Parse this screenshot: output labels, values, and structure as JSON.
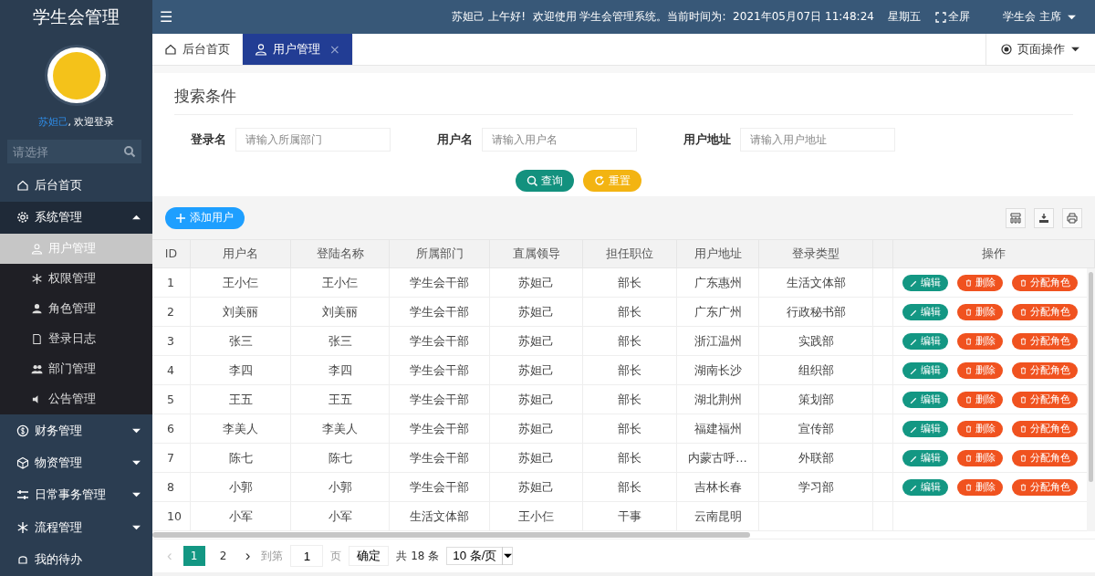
{
  "sidebar": {
    "title": "学生会管理",
    "user_name": "苏妲己",
    "welcome": ", 欢迎登录",
    "search": {
      "placeholder": "请选择"
    },
    "items": [
      {
        "kind": "link",
        "label": "后台首页"
      },
      {
        "kind": "group",
        "label": "系统管理",
        "expanded": true,
        "children": [
          {
            "label": "用户管理",
            "selected": true
          },
          {
            "label": "权限管理",
            "selected": false
          },
          {
            "label": "角色管理",
            "selected": false
          },
          {
            "label": "登录日志",
            "selected": false
          },
          {
            "label": "部门管理",
            "selected": false
          },
          {
            "label": "公告管理",
            "selected": false
          }
        ]
      },
      {
        "kind": "group",
        "label": "财务管理",
        "expanded": false
      },
      {
        "kind": "group",
        "label": "物资管理",
        "expanded": false
      },
      {
        "kind": "group",
        "label": "日常事务管理",
        "expanded": false
      },
      {
        "kind": "group",
        "label": "流程管理",
        "expanded": false
      },
      {
        "kind": "link",
        "label": "我的待办"
      }
    ]
  },
  "topbar": {
    "menu_glyph": "☰",
    "greeting": "苏妲己 上午好!  欢迎使用 学生会管理系统。当前时间为:  2021年05月07日 11:48:24    星期五",
    "fullscreen": "全屏",
    "user": "学生会 主席"
  },
  "tabs": [
    {
      "label": "后台首页",
      "selected": false,
      "closable": false
    },
    {
      "label": "用户管理",
      "selected": true,
      "closable": true,
      "close_glyph": "×"
    }
  ],
  "page_actions": "页面操作",
  "search": {
    "title": "搜索条件",
    "fields": [
      {
        "label": "登录名",
        "placeholder": "请输入所属部门"
      },
      {
        "label": "用户名",
        "placeholder": "请输入用户名"
      },
      {
        "label": "用户地址",
        "placeholder": "请输入用户地址"
      }
    ],
    "buttons": [
      {
        "kind": "query",
        "label": "查询"
      },
      {
        "kind": "reset",
        "label": "重置"
      }
    ]
  },
  "toolbar": {
    "add_button": "添加用户"
  },
  "table": {
    "columns": [
      "ID",
      "用户名",
      "登陆名称",
      "所属部门",
      "直属领导",
      "担任职位",
      "用户地址",
      "登录类型",
      "",
      "操作"
    ],
    "rows": [
      {
        "cells": [
          "1",
          "王小仨",
          "王小仨",
          "学生会干部",
          "苏妲己",
          "部长",
          "广东惠州",
          "生活文体部"
        ],
        "actions": [
          {
            "kind": "edit",
            "label": "编辑"
          },
          {
            "kind": "delete",
            "label": "删除"
          },
          {
            "kind": "assign",
            "label": "分配角色"
          }
        ]
      },
      {
        "cells": [
          "2",
          "刘美丽",
          "刘美丽",
          "学生会干部",
          "苏妲己",
          "部长",
          "广东广州",
          "行政秘书部"
        ],
        "actions": [
          {
            "kind": "edit",
            "label": "编辑"
          },
          {
            "kind": "delete",
            "label": "删除"
          },
          {
            "kind": "assign",
            "label": "分配角色"
          }
        ]
      },
      {
        "cells": [
          "3",
          "张三",
          "张三",
          "学生会干部",
          "苏妲己",
          "部长",
          "浙江温州",
          "实践部"
        ],
        "actions": [
          {
            "kind": "edit",
            "label": "编辑"
          },
          {
            "kind": "delete",
            "label": "删除"
          },
          {
            "kind": "assign",
            "label": "分配角色"
          }
        ]
      },
      {
        "cells": [
          "4",
          "李四",
          "李四",
          "学生会干部",
          "苏妲己",
          "部长",
          "湖南长沙",
          "组织部"
        ],
        "actions": [
          {
            "kind": "edit",
            "label": "编辑"
          },
          {
            "kind": "delete",
            "label": "删除"
          },
          {
            "kind": "assign",
            "label": "分配角色"
          }
        ]
      },
      {
        "cells": [
          "5",
          "王五",
          "王五",
          "学生会干部",
          "苏妲己",
          "部长",
          "湖北荆州",
          "策划部"
        ],
        "actions": [
          {
            "kind": "edit",
            "label": "编辑"
          },
          {
            "kind": "delete",
            "label": "删除"
          },
          {
            "kind": "assign",
            "label": "分配角色"
          }
        ]
      },
      {
        "cells": [
          "6",
          "李美人",
          "李美人",
          "学生会干部",
          "苏妲己",
          "部长",
          "福建福州",
          "宣传部"
        ],
        "actions": [
          {
            "kind": "edit",
            "label": "编辑"
          },
          {
            "kind": "delete",
            "label": "删除"
          },
          {
            "kind": "assign",
            "label": "分配角色"
          }
        ]
      },
      {
        "cells": [
          "7",
          "陈七",
          "陈七",
          "学生会干部",
          "苏妲己",
          "部长",
          "内蒙古呼…",
          "外联部"
        ],
        "actions": [
          {
            "kind": "edit",
            "label": "编辑"
          },
          {
            "kind": "delete",
            "label": "删除"
          },
          {
            "kind": "assign",
            "label": "分配角色"
          }
        ]
      },
      {
        "cells": [
          "8",
          "小郭",
          "小郭",
          "学生会干部",
          "苏妲己",
          "部长",
          "吉林长春",
          "学习部"
        ],
        "actions": [
          {
            "kind": "edit",
            "label": "编辑"
          },
          {
            "kind": "delete",
            "label": "删除"
          },
          {
            "kind": "assign",
            "label": "分配角色"
          }
        ]
      },
      {
        "cells": [
          "10",
          "小军",
          "小军",
          "生活文体部",
          "王小仨",
          "干事",
          "云南昆明"
        ]
      }
    ]
  },
  "pagination": {
    "prev_glyph": "‹",
    "pages": [
      {
        "label": "1",
        "selected": true
      },
      {
        "label": "2",
        "selected": false
      }
    ],
    "next_glyph": "›",
    "goto_label": "到第",
    "goto_value": "1",
    "page_label": "页",
    "confirm": "确定",
    "total": "共 18 条",
    "page_size": "10 条/页"
  }
}
